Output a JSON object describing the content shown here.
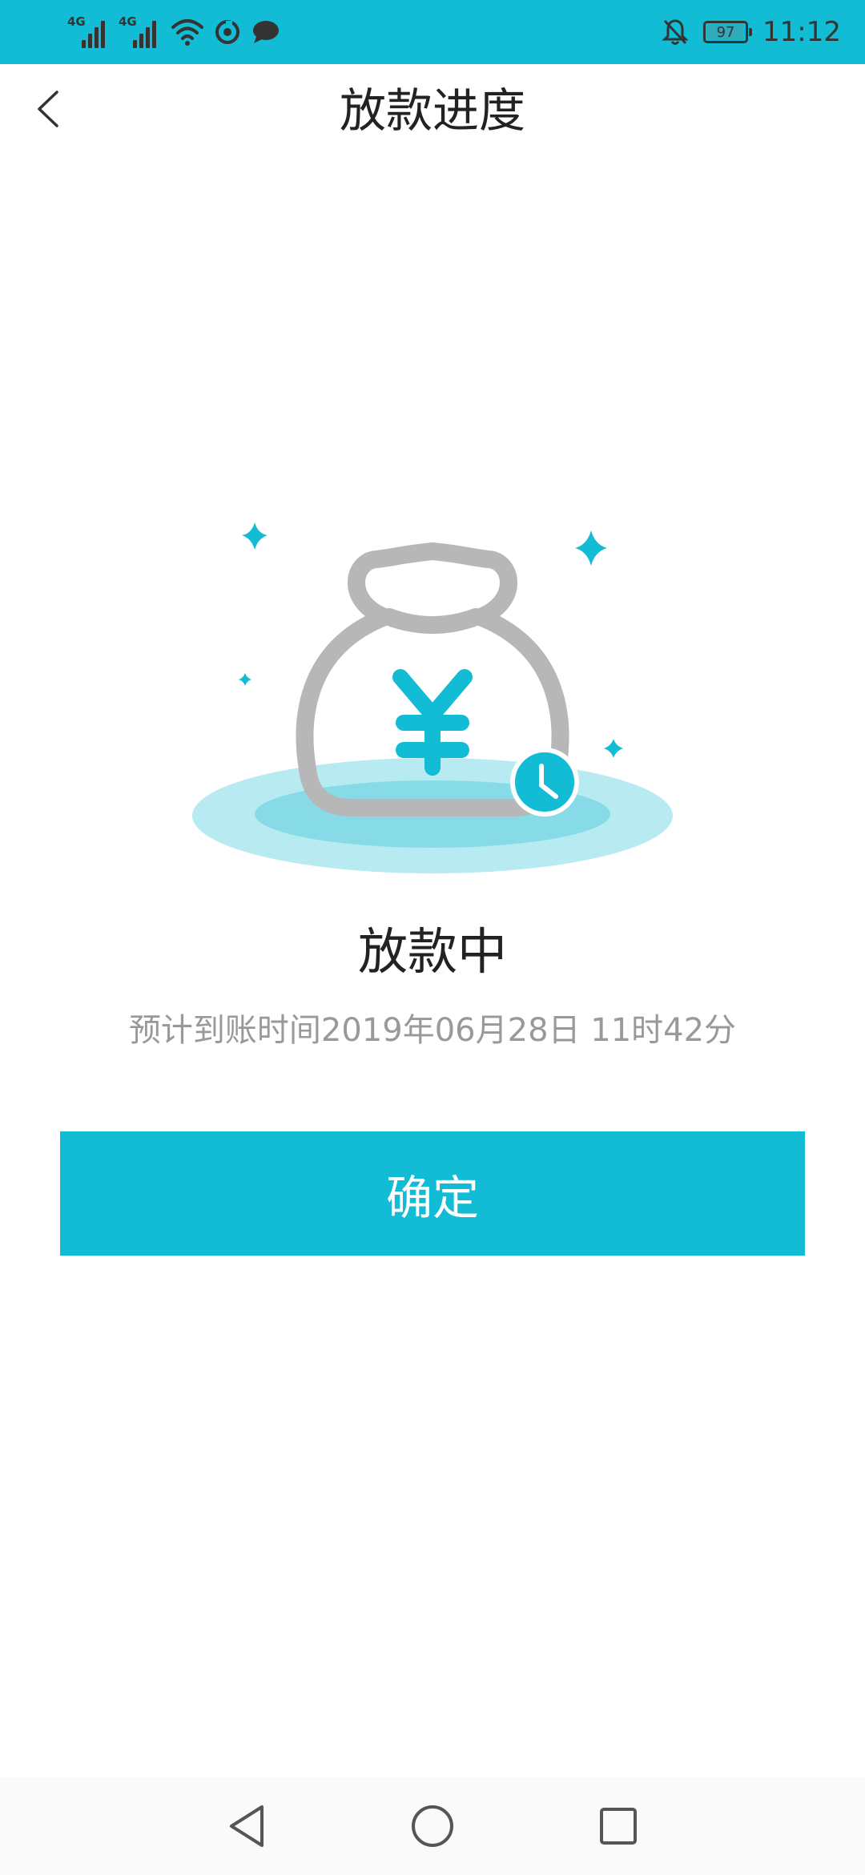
{
  "status_bar": {
    "signal_1_label": "4G",
    "signal_2_label": "4G",
    "battery_level": "97",
    "battery_fraction": 0.97,
    "time": "11:12",
    "icons": [
      "signal-icon",
      "signal-icon",
      "wifi-icon",
      "app-notification-icon",
      "message-icon",
      "notification-muted-icon",
      "battery-icon"
    ]
  },
  "nav": {
    "title": "放款进度",
    "back_icon": "chevron-left-icon"
  },
  "illustration": {
    "icon": "money-bag-icon",
    "symbol": "¥",
    "clock_icon": "clock-icon"
  },
  "status": {
    "title": "放款中",
    "subtitle": "预计到账时间2019年06月28日 11时42分"
  },
  "actions": {
    "confirm_label": "确定"
  },
  "system_nav": {
    "icons": [
      "back-triangle-icon",
      "home-circle-icon",
      "recents-square-icon"
    ]
  },
  "colors": {
    "accent": "#12bcd4",
    "bag_outline": "#b7b7b7",
    "text_primary": "#222222",
    "text_secondary": "#999999"
  }
}
